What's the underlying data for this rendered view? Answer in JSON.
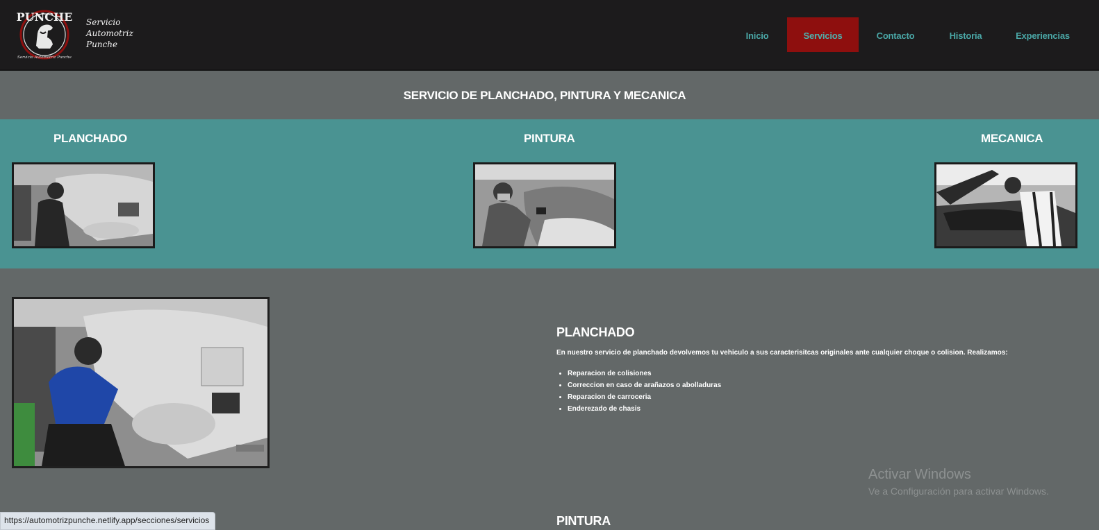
{
  "header": {
    "logo_text": "PUNCHE",
    "logo_subtext": "Servicio Automotriz Punche",
    "tagline": [
      "Servicio",
      "Automotriz",
      "Punche"
    ],
    "nav": [
      {
        "label": "Inicio",
        "active": false
      },
      {
        "label": "Servicios",
        "active": true
      },
      {
        "label": "Contacto",
        "active": false
      },
      {
        "label": "Historia",
        "active": false
      },
      {
        "label": "Experiencias",
        "active": false
      }
    ]
  },
  "page_title": "SERVICIO DE PLANCHADO, PINTURA Y MECANICA",
  "services": [
    {
      "title": "PLANCHADO"
    },
    {
      "title": "PINTURA"
    },
    {
      "title": "MECANICA"
    }
  ],
  "detail": {
    "heading": "PLANCHADO",
    "description": "En nuestro servicio de planchado devolvemos tu vehiculo a sus caracterisitcas originales ante cualquier choque o colision. Realizamos:",
    "items": [
      "Reparacion de colisiones",
      "Correccion en caso de arañazos o abolladuras",
      "Reparacion de carroceria",
      "Enderezado de chasis"
    ],
    "next_heading": "PINTURA"
  },
  "watermark": {
    "line1": "Activar Windows",
    "line2": "Ve a Configuración para activar Windows."
  },
  "status_url": "https://automotrizpunche.netlify.app/secciones/servicios",
  "colors": {
    "header_bg": "#1c1b1c",
    "nav_active_bg": "#8e0f0e",
    "nav_text": "#4aa7a6",
    "body_bg": "#636868",
    "teal_band": "#4a9392"
  }
}
